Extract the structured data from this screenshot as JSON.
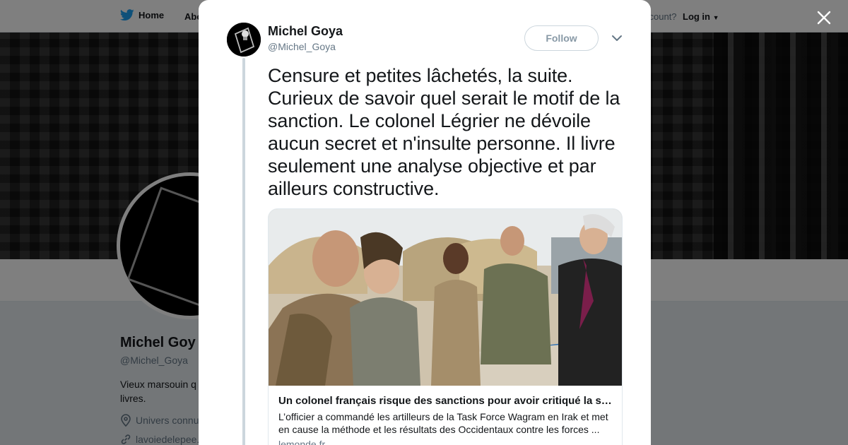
{
  "nav": {
    "home": "Home",
    "about": "Abo",
    "account_prompt": "ccount?",
    "login": "Log in"
  },
  "profile": {
    "name": "Michel Goy",
    "handle": "@Michel_Goya",
    "bio": "Vieux marsouin q livres.",
    "location": "Univers connu",
    "link": "lavoiedelepee."
  },
  "tweet": {
    "author_name": "Michel Goya",
    "author_handle": "@Michel_Goya",
    "follow_label": "Follow",
    "text": "Censure et petites lâchetés, la suite. Curieux de savoir quel serait le motif de la sanction. Le colonel Légrier ne dévoile aucun secret et n'insulte personne. Il livre seulement une analyse objective et par ailleurs constructive.",
    "card": {
      "title": "Un colonel français risque des sanctions pour avoir critiqué la stratégie",
      "description": "L’officier a commandé les artilleurs de la Task Force Wagram en Irak et met en cause la méthode et les résultats des Occidentaux contre les forces ...",
      "domain": "lemonde.fr"
    }
  },
  "colors": {
    "twitter_blue": "#1da1f2",
    "text_primary": "#14171a",
    "text_secondary": "#657786",
    "border": "#e1e8ed",
    "overlay": "rgba(0,0,0,0.5)"
  },
  "icons": {
    "nav_home": "twitter-bird-icon",
    "close": "close-icon",
    "caret": "chevron-down-icon",
    "location": "location-pin-icon",
    "link": "link-icon"
  }
}
